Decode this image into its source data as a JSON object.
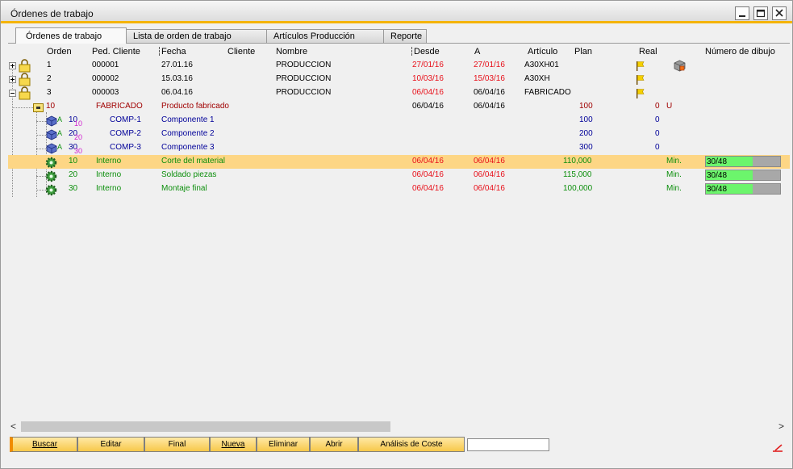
{
  "window": {
    "title": "Órdenes de trabajo"
  },
  "tabs": [
    {
      "label": "Órdenes de trabajo"
    },
    {
      "label": "Lista de orden de trabajo"
    },
    {
      "label": "Artículos Producción"
    },
    {
      "label": "Reporte"
    }
  ],
  "columns": {
    "orden": "Orden",
    "ped_cliente": "Ped. Cliente",
    "fecha": "Fecha",
    "cliente": "Cliente",
    "nombre": "Nombre",
    "desde": "Desde",
    "a": "A",
    "articulo": "Artículo",
    "plan": "Plan",
    "real": "Real",
    "numero_dibujo": "Número de dibujo"
  },
  "orders": [
    {
      "orden": "1",
      "ped_cliente": "000001",
      "fecha": "27.01.16",
      "nombre": "PRODUCCION",
      "desde": "27/01/16",
      "a": "27/01/16",
      "articulo": "A30XH01"
    },
    {
      "orden": "2",
      "ped_cliente": "000002",
      "fecha": "15.03.16",
      "nombre": "PRODUCCION",
      "desde": "10/03/16",
      "a": "15/03/16",
      "articulo": "A30XH"
    },
    {
      "orden": "3",
      "ped_cliente": "000003",
      "fecha": "06.04.16",
      "nombre": "PRODUCCION",
      "desde": "06/04/16",
      "a": "06/04/16",
      "articulo": "FABRICADO"
    }
  ],
  "product": {
    "num": "10",
    "code": "FABRICADO",
    "name": "Producto fabricado",
    "desde": "06/04/16",
    "a": "06/04/16",
    "plan": "100",
    "real": "0",
    "unit": "U"
  },
  "components": [
    {
      "flag": "A",
      "num": "10",
      "sub": "10",
      "code": "COMP-1",
      "name": "Componente 1",
      "plan": "100",
      "real": "0"
    },
    {
      "flag": "A",
      "num": "20",
      "sub": "20",
      "code": "COMP-2",
      "name": "Componente 2",
      "plan": "200",
      "real": "0"
    },
    {
      "flag": "A",
      "num": "30",
      "sub": "30",
      "code": "COMP-3",
      "name": "Componente 3",
      "plan": "300",
      "real": "0"
    }
  ],
  "operations": [
    {
      "num": "10",
      "type": "Interno",
      "name": "Corte del material",
      "desde": "06/04/16",
      "a": "06/04/16",
      "plan": "110,000",
      "unit": "Min.",
      "progress_text": "30/48",
      "progress": 0.63
    },
    {
      "num": "20",
      "type": "Interno",
      "name": "Soldado piezas",
      "desde": "06/04/16",
      "a": "06/04/16",
      "plan": "115,000",
      "unit": "Min.",
      "progress_text": "30/48",
      "progress": 0.63
    },
    {
      "num": "30",
      "type": "Interno",
      "name": "Montaje final",
      "desde": "06/04/16",
      "a": "06/04/16",
      "plan": "100,000",
      "unit": "Min.",
      "progress_text": "30/48",
      "progress": 0.63
    }
  ],
  "buttons": {
    "buscar": "Buscar",
    "editar": "Editar",
    "final": "Final",
    "nueva": "Nueva",
    "eliminar": "Eliminar",
    "abrir": "Abrir",
    "analisis": "Análisis de Coste"
  },
  "scroll": {
    "left": "<",
    "right": ">"
  },
  "colors": {
    "accent": "#f5b400",
    "selected_row": "#fdd685",
    "button": "#f7c84a",
    "late_date": "#e8101a",
    "operation": "#0d8f0d",
    "component": "#000099"
  },
  "icons": [
    "minimize-icon",
    "maximize-icon",
    "close-icon",
    "expand-icon",
    "collapse-icon",
    "lock-icon",
    "folder-icon",
    "cube-icon",
    "gear-icon",
    "flag-icon",
    "box-icon",
    "corner-logo-icon"
  ]
}
